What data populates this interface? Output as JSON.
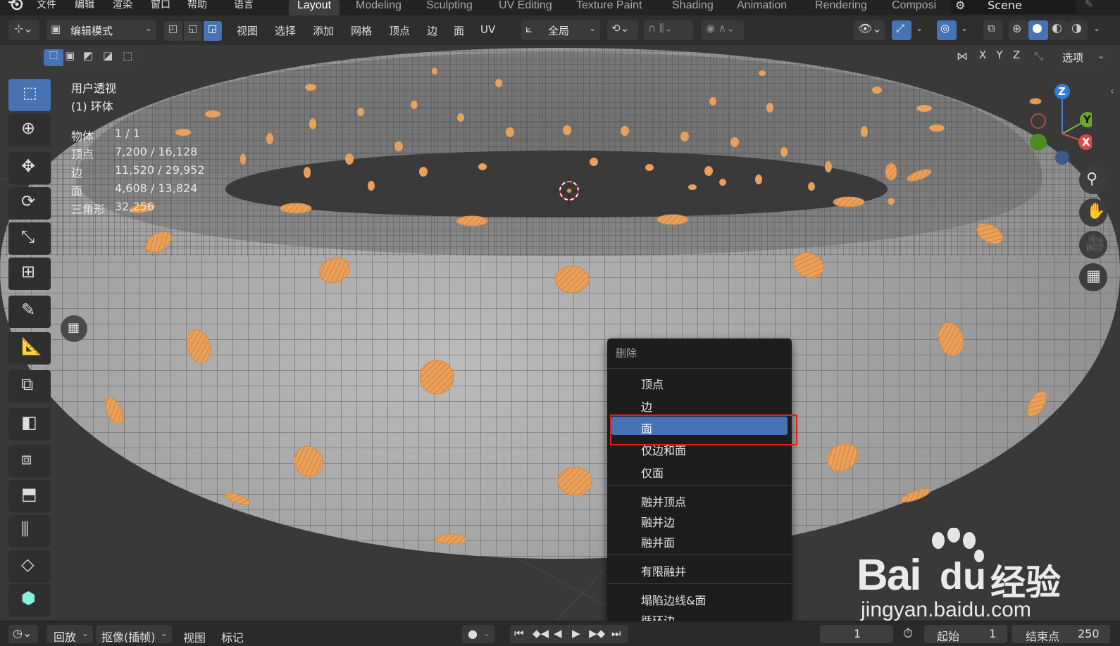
{
  "menubar": {
    "items": [
      "文件",
      "编辑",
      "渲染",
      "窗口",
      "帮助",
      "语言"
    ],
    "workspaces": [
      "Layout",
      "Modeling",
      "Sculpting",
      "UV Editing",
      "Texture Paint",
      "Shading",
      "Animation",
      "Rendering",
      "Composi"
    ],
    "active_workspace": "Layout",
    "scene_label": "Scene"
  },
  "header": {
    "mode": "编辑模式",
    "menus": [
      "视图",
      "选择",
      "添加",
      "网格",
      "顶点",
      "边",
      "面",
      "UV"
    ],
    "transform_orientation": "全局",
    "axis_x": "X",
    "axis_y": "Y",
    "axis_z": "Z",
    "options_label": "选项"
  },
  "overlay_info": {
    "view_name": "用户透视",
    "object_name": "(1) 环体",
    "stats": [
      {
        "label": "物体",
        "value": "1 / 1"
      },
      {
        "label": "顶点",
        "value": "7,200 / 16,128"
      },
      {
        "label": "边",
        "value": "11,520 / 29,952"
      },
      {
        "label": "面",
        "value": "4,608 / 13,824"
      },
      {
        "label": "三角形",
        "value": "32,256"
      }
    ]
  },
  "gizmo": {
    "z": "Z",
    "y": "Y",
    "x": "X"
  },
  "context_menu": {
    "title": "删除",
    "items": [
      "顶点",
      "边",
      "面",
      "仅边和面",
      "仅面",
      "融并顶点",
      "融并边",
      "融并面",
      "有限融并",
      "塌陷边线&面",
      "循环边"
    ],
    "highlighted": "面"
  },
  "timeline": {
    "playback": "回放",
    "keying": "抠像(插帧)",
    "view": "视图",
    "marker": "标记",
    "current_frame": "1",
    "start_label": "起始",
    "start_value": "1",
    "end_label": "结束点",
    "end_value": "250"
  },
  "watermark": {
    "brand": "Bai",
    "brand2": "du",
    "brand_cn": "经验",
    "url": "jingyan.baidu.com"
  },
  "colors": {
    "accent_blue": "#4772b3",
    "selection_orange": "#e8a05a",
    "highlight_red": "#e02020"
  }
}
